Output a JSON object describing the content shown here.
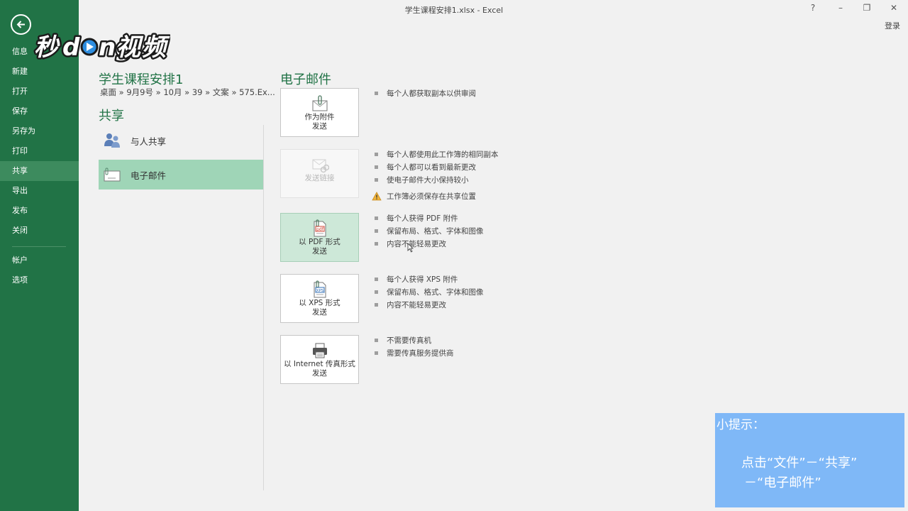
{
  "window": {
    "title": "学生课程安排1.xlsx - Excel",
    "help": "?",
    "minimize": "–",
    "restore": "❐",
    "close": "✕",
    "login": "登录"
  },
  "watermark": {
    "text": "秒懂视频"
  },
  "sidebar": {
    "items": [
      {
        "label": "信息"
      },
      {
        "label": "新建"
      },
      {
        "label": "打开"
      },
      {
        "label": "保存"
      },
      {
        "label": "另存为"
      },
      {
        "label": "打印"
      },
      {
        "label": "共享",
        "active": true
      },
      {
        "label": "导出"
      },
      {
        "label": "发布"
      },
      {
        "label": "关闭"
      },
      {
        "label": "帐户"
      },
      {
        "label": "选项"
      }
    ]
  },
  "document": {
    "title": "学生课程安排1",
    "path": "桌面 » 9月9号 » 10月 » 39 » 文案 » 575.Ex..."
  },
  "share": {
    "title": "共享",
    "items": [
      {
        "label": "与人共享",
        "icon": "people-icon"
      },
      {
        "label": "电子邮件",
        "icon": "email-icon",
        "active": true
      }
    ]
  },
  "email": {
    "title": "电子邮件",
    "options": [
      {
        "line1": "作为附件",
        "line2": "发送",
        "icon": "attachment-icon",
        "bullets": [
          "每个人都获取副本以供审阅"
        ]
      },
      {
        "line1": "发送链接",
        "line2": "",
        "icon": "link-icon",
        "disabled": true,
        "bullets": [
          "每个人都使用此工作簿的相同副本",
          "每个人都可以看到最新更改",
          "使电子邮件大小保持较小"
        ],
        "warning": "工作簿必须保存在共享位置"
      },
      {
        "line1": "以 PDF 形式",
        "line2": "发送",
        "icon": "pdf-icon",
        "hover": true,
        "bullets": [
          "每个人获得 PDF 附件",
          "保留布局、格式、字体和图像",
          "内容不能轻易更改"
        ]
      },
      {
        "line1": "以 XPS 形式",
        "line2": "发送",
        "icon": "xps-icon",
        "bullets": [
          "每个人获得 XPS 附件",
          "保留布局、格式、字体和图像",
          "内容不能轻易更改"
        ]
      },
      {
        "line1": "以 Internet 传真形式",
        "line2": "发送",
        "icon": "fax-icon",
        "bullets": [
          "不需要传真机",
          "需要传真服务提供商"
        ]
      }
    ]
  },
  "tip": {
    "title": "小提示：",
    "line1": "点击“文件”－“共享”",
    "line2": "－“电子邮件”"
  },
  "colors": {
    "sidebar": "#217346",
    "sidebar_active": "#3d8b5e",
    "accent": "#217346",
    "share_active": "#9fd5b7",
    "tip_bg": "#7fb8f7"
  }
}
